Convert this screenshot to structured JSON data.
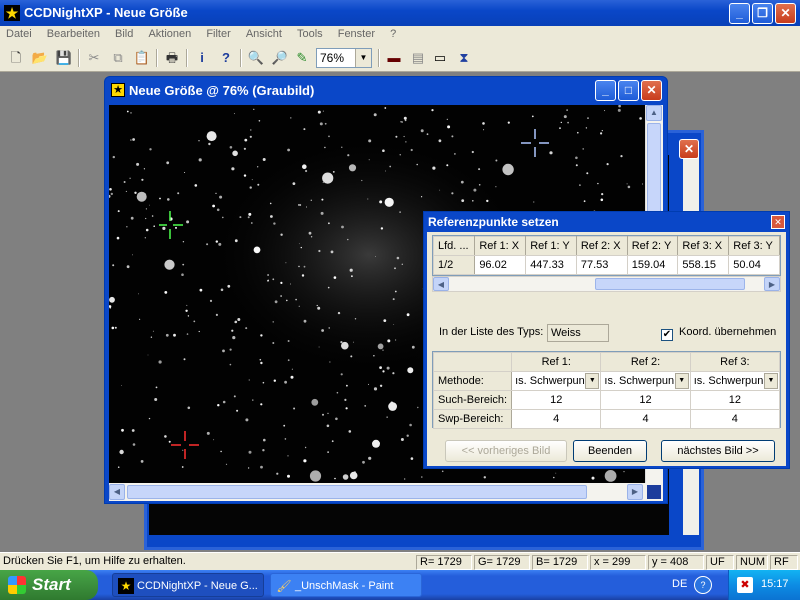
{
  "window": {
    "title": "CCDNightXP - Neue Größe"
  },
  "menu": [
    "Datei",
    "Bearbeiten",
    "Bild",
    "Aktionen",
    "Filter",
    "Ansicht",
    "Tools",
    "Fenster",
    "?"
  ],
  "toolbar": {
    "zoom": "76%"
  },
  "image_window": {
    "title": "Neue Größe @ 76% (Graubild)"
  },
  "dialog": {
    "title": "Referenzpunkte setzen",
    "grid1": {
      "headers": [
        "Lfd. ...",
        "Ref 1: X",
        "Ref 1: Y",
        "Ref 2: X",
        "Ref 2: Y",
        "Ref 3: X",
        "Ref 3: Y"
      ],
      "row": [
        "1/2",
        "96.02",
        "447.33",
        "77.53",
        "159.04",
        "558.15",
        "50.04"
      ]
    },
    "type_label": "In der Liste des Typs:",
    "type_value": "Weiss",
    "koord_label": "Koord. übernehmen",
    "grid2": {
      "headers": [
        "Ref 1:",
        "Ref 2:",
        "Ref 3:"
      ],
      "rows": [
        {
          "label": "Methode:",
          "values": [
            "ıs. Schwerpun",
            "ıs. Schwerpun",
            "ıs. Schwerpun"
          ]
        },
        {
          "label": "Such-Bereich:",
          "values": [
            "12",
            "12",
            "12"
          ]
        },
        {
          "label": "Swp-Bereich:",
          "values": [
            "4",
            "4",
            "4"
          ]
        }
      ]
    },
    "buttons": {
      "prev": "<< vorheriges Bild",
      "end": "Beenden",
      "next": "nächstes Bild >>"
    }
  },
  "statusbar": {
    "help": "Drücken Sie F1, um Hilfe zu erhalten.",
    "r": "R= 1729",
    "g": "G= 1729",
    "b": "B= 1729",
    "x": "x = 299",
    "y": "y = 408",
    "uf": "UF",
    "num": "NUM",
    "rf": "RF"
  },
  "taskbar": {
    "start": "Start",
    "tasks": [
      "CCDNightXP - Neue G...",
      "_UnschMask - Paint"
    ],
    "lang": "DE",
    "clock": "15:17"
  },
  "colors": {
    "titlebar": "#0a47c8",
    "marker_green": "#4cff4c",
    "marker_red": "#ff3030",
    "marker_blue": "#b0c8ff"
  }
}
